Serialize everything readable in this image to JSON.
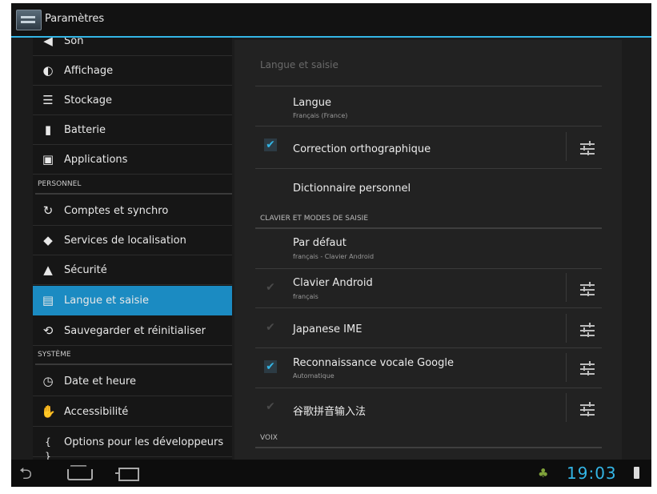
{
  "app_title": "Paramètres",
  "sidebar": {
    "items": [
      {
        "label": "Son",
        "icon": "speaker-icon"
      },
      {
        "label": "Affichage",
        "icon": "brightness-icon"
      },
      {
        "label": "Stockage",
        "icon": "storage-icon"
      },
      {
        "label": "Batterie",
        "icon": "battery-icon"
      },
      {
        "label": "Applications",
        "icon": "apps-icon"
      },
      {
        "label": "Comptes et synchro",
        "icon": "sync-icon"
      },
      {
        "label": "Services de localisation",
        "icon": "location-icon"
      },
      {
        "label": "Sécurité",
        "icon": "lock-icon"
      },
      {
        "label": "Langue et saisie",
        "icon": "keyboard-icon"
      },
      {
        "label": "Sauvegarder et réinitialiser",
        "icon": "backup-icon"
      },
      {
        "label": "Date et heure",
        "icon": "clock-icon"
      },
      {
        "label": "Accessibilité",
        "icon": "hand-icon"
      },
      {
        "label": "Options pour les développeurs",
        "icon": "braces-icon"
      }
    ],
    "headers": {
      "personal": "PERSONNEL",
      "system": "SYSTÈME"
    },
    "selected": "Langue et saisie"
  },
  "content": {
    "title": "Langue et saisie",
    "language": {
      "title": "Langue",
      "subtitle": "Français (France)"
    },
    "spellcheck": {
      "title": "Correction orthographique",
      "checked": true
    },
    "dictionary": {
      "title": "Dictionnaire personnel"
    },
    "keyboard_header": "CLAVIER ET MODES DE SAISIE",
    "default": {
      "title": "Par défaut",
      "subtitle": "français - Clavier Android"
    },
    "android_keyboard": {
      "title": "Clavier Android",
      "subtitle": "français",
      "checked": false
    },
    "japanese_ime": {
      "title": "Japanese IME",
      "checked": false
    },
    "google_voice": {
      "title": "Reconnaissance vocale Google",
      "subtitle": "Automatique",
      "checked": true
    },
    "pinyin": {
      "title": "谷歌拼音输入法",
      "checked": false
    },
    "voice_header": "VOIX"
  },
  "statusbar": {
    "time": "19:03"
  },
  "colors": {
    "accent": "#33b5e5",
    "selection": "#1b8bc2",
    "background": "#1c1c1c"
  }
}
